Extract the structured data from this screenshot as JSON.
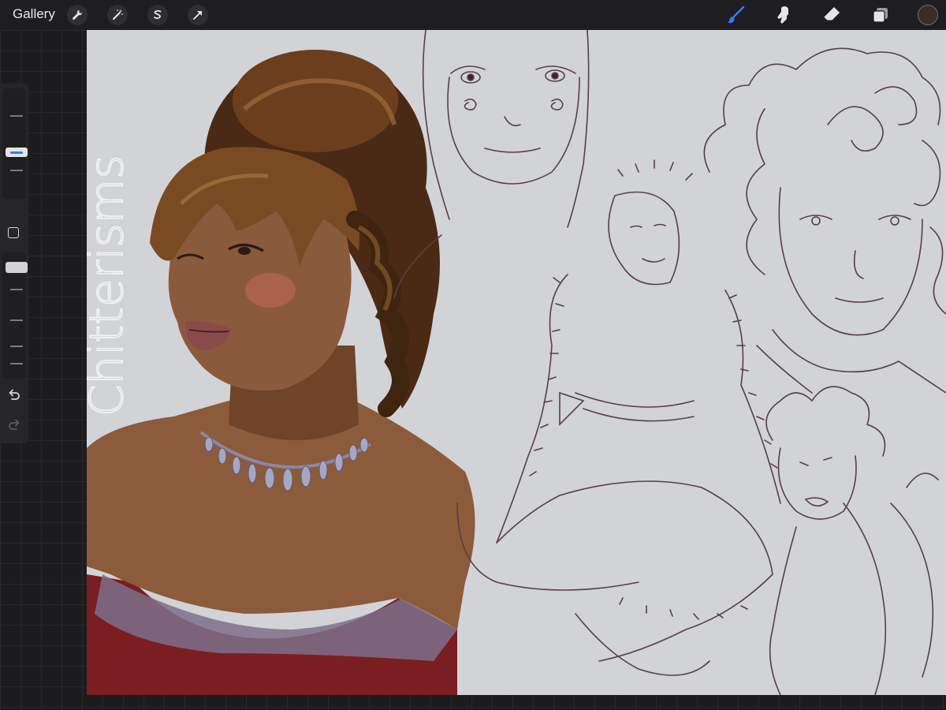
{
  "toolbar": {
    "gallery_label": "Gallery",
    "left_tools": [
      "wrench-icon",
      "magic-wand-icon",
      "selection-icon",
      "transform-arrow-icon"
    ],
    "right_tools": [
      "brush-icon",
      "smudge-icon",
      "eraser-icon",
      "layers-icon"
    ],
    "active_tool": "brush-icon",
    "current_color": "#3b2c27"
  },
  "sidebar": {
    "brush_size_level": 0.45,
    "opacity_level": 0.15,
    "buttons": [
      "modify-button",
      "undo-icon",
      "redo-icon"
    ]
  },
  "canvas": {
    "background": "#d1d3d7",
    "watermark_text": "Chitterisms"
  },
  "colors": {
    "accent": "#2f7df6",
    "skin": "#8a5a3c",
    "hair": "#6b3f1e",
    "sketch_line": "#5a3d4a"
  }
}
